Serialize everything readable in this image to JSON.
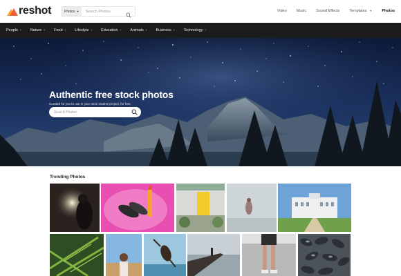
{
  "header": {
    "logo_text": "reshot",
    "search_type": "Photos",
    "search_placeholder": "Search Photos",
    "nav": [
      {
        "label": "Video"
      },
      {
        "label": "Music"
      },
      {
        "label": "Sound Effects"
      },
      {
        "label": "Templates"
      },
      {
        "label": "Photos"
      }
    ]
  },
  "categories": [
    {
      "label": "People"
    },
    {
      "label": "Nature"
    },
    {
      "label": "Food"
    },
    {
      "label": "Lifestyle"
    },
    {
      "label": "Education"
    },
    {
      "label": "Animals"
    },
    {
      "label": "Business"
    },
    {
      "label": "Technology"
    }
  ],
  "hero": {
    "title": "Authentic free stock photos",
    "subtitle": "Curated for you to use in your next creative project, for free.",
    "search_placeholder": "Search Photos"
  },
  "trending": {
    "title": "Trending Photos"
  },
  "colors": {
    "brand_orange": "#f25f3a",
    "category_bar": "#1c1c1c",
    "hero_sky": "#1a2f5c"
  }
}
